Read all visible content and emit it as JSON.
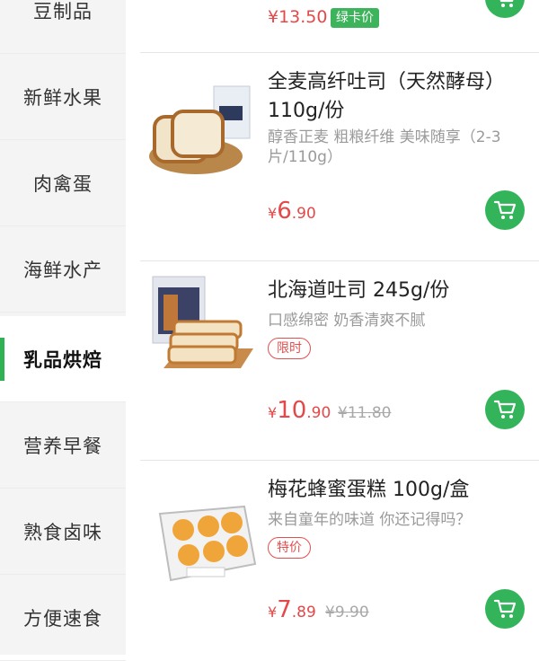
{
  "categories": [
    {
      "label": "豆制品"
    },
    {
      "label": "新鲜水果"
    },
    {
      "label": "肉禽蛋"
    },
    {
      "label": "海鲜水产"
    },
    {
      "label": "乳品烘焙",
      "active": true
    },
    {
      "label": "营养早餐"
    },
    {
      "label": "熟食卤味"
    },
    {
      "label": "方便速食"
    }
  ],
  "top_item": {
    "price": "¥13.50",
    "card_badge": "绿卡价"
  },
  "products": [
    {
      "title": "全麦高纤吐司（天然酵母）110g/份",
      "desc": "醇香正麦 粗粮纤维 美味随享（2-3片/110g）",
      "price_symbol": "¥",
      "price_int": "6",
      "price_dec": ".90"
    },
    {
      "title": "北海道吐司 245g/份",
      "desc": "口感绵密 奶香清爽不腻",
      "tag": "限时",
      "price_symbol": "¥",
      "price_int": "10",
      "price_dec": ".90",
      "old_price": "¥11.80"
    },
    {
      "title": "梅花蜂蜜蛋糕 100g/盒",
      "desc": "来自童年的味道 你还记得吗？",
      "tag": "特价",
      "price_symbol": "¥",
      "price_int": "7",
      "price_dec": ".89",
      "old_price": "¥9.90"
    }
  ],
  "icons": {
    "cart": "cart-icon"
  },
  "colors": {
    "accent_green": "#33b45a",
    "price_red": "#e54848"
  }
}
